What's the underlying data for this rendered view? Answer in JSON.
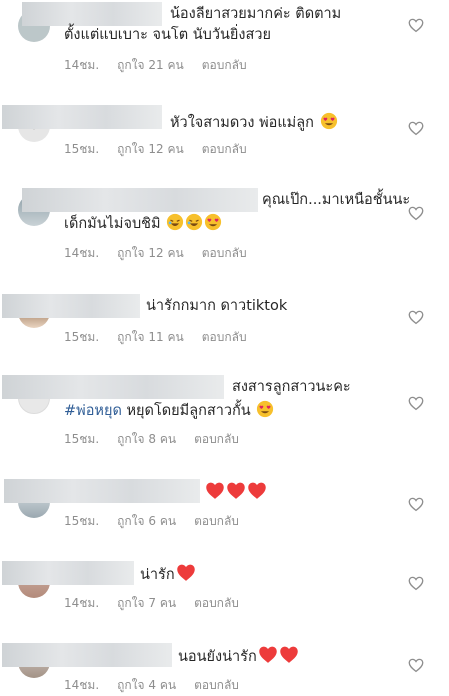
{
  "colors": {
    "text": "#262626",
    "meta": "#8e8e8e",
    "hashtag": "#2f5d96",
    "heart_red": "#ed3b3b",
    "emoji_yellow": "#f7c02c"
  },
  "comments": [
    {
      "line1": "น้องลียาสวยมากค่ะ ติดตาม",
      "line2": "ตั้งแต่แบเบาะ จนโต นับวันยิ่งสวย",
      "time": "14ชม.",
      "likes": "ถูกใจ 21 คน",
      "reply": "ตอบกลับ"
    },
    {
      "line1": "หัวใจสามดวง พ่อแม่ลูก",
      "time": "15ชม.",
      "likes": "ถูกใจ 12 คน",
      "reply": "ตอบกลับ"
    },
    {
      "line1": "คุณเป๊ก...มาเหนือชั้นนะ",
      "line2": "เด็กมันไม่จบชิมิ",
      "time": "14ชม.",
      "likes": "ถูกใจ 12 คน",
      "reply": "ตอบกลับ"
    },
    {
      "line1": "น่ารักกมาก ดาวtiktok",
      "time": "15ชม.",
      "likes": "ถูกใจ 11 คน",
      "reply": "ตอบกลับ"
    },
    {
      "line1": "สงสารลูกสาวนะคะ",
      "hashtag": "#พ่อหยุด",
      "line2_rest": " หยุดโดยมีลูกสาวกั้น",
      "time": "15ชม.",
      "likes": "ถูกใจ 8 คน",
      "reply": "ตอบกลับ"
    },
    {
      "line1": "",
      "time": "15ชม.",
      "likes": "ถูกใจ 6 คน",
      "reply": "ตอบกลับ"
    },
    {
      "line1": "น่ารัก",
      "time": "14ชม.",
      "likes": "ถูกใจ 7 คน",
      "reply": "ตอบกลับ"
    },
    {
      "line1": "นอนยังน่ารัก",
      "time": "14ชม.",
      "likes": "ถูกใจ 4 คน",
      "reply": "ตอบกลับ"
    }
  ],
  "icons": {
    "like": "heart-outline-icon"
  }
}
